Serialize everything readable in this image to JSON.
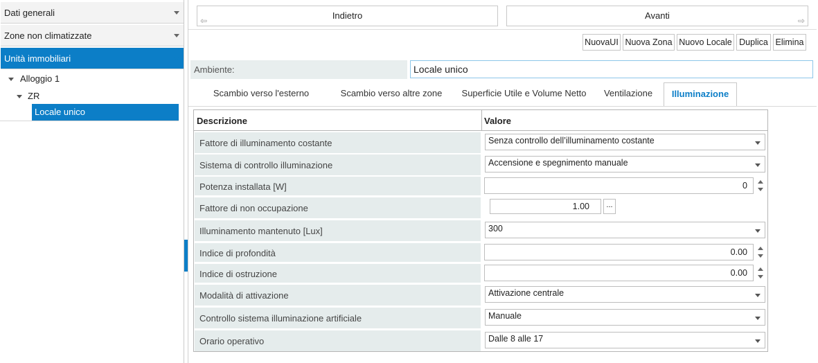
{
  "sidebar": {
    "sections": [
      {
        "label": "Dati generali"
      },
      {
        "label": "Zone non climatizzate"
      },
      {
        "label": "Unità immobiliari"
      }
    ],
    "tree": [
      {
        "label": "Alloggio 1"
      },
      {
        "label": "ZR"
      },
      {
        "label": "Locale unico"
      }
    ]
  },
  "nav": {
    "back_label": "Indietro",
    "forward_label": "Avanti"
  },
  "toolbar": {
    "new_ui": "NuovaUI",
    "new_zone": "Nuova Zona",
    "new_room": "Nuovo Locale",
    "duplicate": "Duplica",
    "delete": "Elimina"
  },
  "ambient": {
    "label": "Ambiente:",
    "value": "Locale unico"
  },
  "tabs": [
    {
      "label": "Scambio verso l'esterno"
    },
    {
      "label": "Scambio verso altre zone"
    },
    {
      "label": "Superficie Utile e Volume Netto"
    },
    {
      "label": "Ventilazione"
    },
    {
      "label": "Illuminazione",
      "active": true
    }
  ],
  "grid": {
    "col_desc": "Descrizione",
    "col_value": "Valore",
    "rows": [
      {
        "label": "Fattore di illuminamento costante",
        "value": "Senza controllo dell’illuminamento costante",
        "kind": "select"
      },
      {
        "label": "Sistema di controllo illuminazione",
        "value": "Accensione e spegnimento manuale",
        "kind": "select"
      },
      {
        "label": "Potenza installata [W]",
        "value": "0",
        "kind": "number"
      },
      {
        "label": "Fattore di non occupazione",
        "value": "1.00",
        "kind": "small"
      },
      {
        "label": "Illuminamento mantenuto [Lux]",
        "value": "300",
        "kind": "select"
      },
      {
        "label": "Indice di profondità",
        "value": "0.00",
        "kind": "number"
      },
      {
        "label": "Indice di ostruzione",
        "value": "0.00",
        "kind": "number"
      },
      {
        "label": "Modalità di attivazione",
        "value": "Attivazione centrale",
        "kind": "select"
      },
      {
        "label": "Controllo sistema illuminazione artificiale",
        "value": "Manuale",
        "kind": "select"
      },
      {
        "label": "Orario operativo",
        "value": "Dalle 8 alle 17",
        "kind": "select"
      }
    ],
    "ellipsis_label": "..."
  },
  "colors": {
    "accent": "#0c7ec7",
    "label_bg": "#e5ecec"
  },
  "icons": {
    "back": "arrow-left-icon",
    "forward": "arrow-right-icon",
    "dropdown": "chevron-down-icon"
  }
}
